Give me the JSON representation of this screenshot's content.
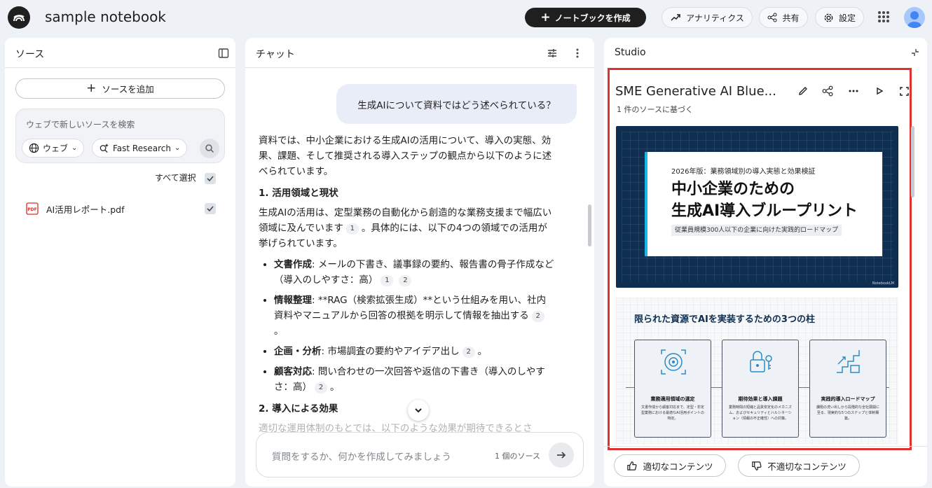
{
  "app": {
    "notebook_title": "sample notebook",
    "create_notebook_label": "ノートブックを作成",
    "analytics_label": "アナリティクス",
    "share_label": "共有",
    "settings_label": "設定"
  },
  "sources": {
    "title": "ソース",
    "add_source_label": "ソースを追加",
    "search_placeholder": "ウェブで新しいソースを検索",
    "web_chip_label": "ウェブ",
    "research_chip_label": "Fast Research",
    "select_all_label": "すべて選択",
    "items": [
      {
        "label": "AI活用レポート.pdf",
        "file_type": "PDF",
        "checked": true
      }
    ]
  },
  "chat": {
    "title": "チャット",
    "user_message": "生成AIについて資料ではどう述べられている？",
    "intro": "資料では、中小企業における生成AIの活用について、導入の実態、効果、課題、そして推奨される導入ステップの観点から以下のように述べられています。",
    "section1_heading": "1. 活用領域と現状",
    "section1_para_a": "生成AIの活用は、定型業務の自動化から創造的な業務支援まで幅広い領域に及んでいます",
    "section1_para_b": "。具体的には、以下の4つの領域での活用が挙げられています。",
    "bullets": [
      {
        "term": "文書作成",
        "text": ": メールの下書き、議事録の要約、報告書の骨子作成など（導入のしやすさ：高）",
        "cites": [
          "1",
          "2"
        ]
      },
      {
        "term": "情報整理",
        "text": ": **RAG（検索拡張生成）**という仕組みを用い、社内資料やマニュアルから回答の根拠を明示して情報を抽出する",
        "cites": [
          "2"
        ],
        "suffix": "。"
      },
      {
        "term": "企画・分析",
        "text": ": 市場調査の要約やアイデア出し",
        "cites": [
          "2"
        ],
        "suffix": "。"
      },
      {
        "term": "顧客対応",
        "text": ": 問い合わせの一次回答や返信の下書き（導入のしやすさ：高）",
        "cites": [
          "2"
        ],
        "suffix": "。"
      }
    ],
    "section2_heading": "2. 導入による効果",
    "section2_cut": "適切な運用体制のもとでは、以下のような効果が期待できるとさ",
    "cite_1": "1",
    "composer_placeholder": "質問をするか、何かを作成してみましょう",
    "source_count": "1 個のソース"
  },
  "studio": {
    "title": "Studio",
    "doc_title": "SME Generative AI Blue...",
    "based_on": "1 件のソースに基づく",
    "slide1": {
      "kicker": "2026年版：業務領域別の導入実態と効果検証",
      "headline_line1": "中小企業のための",
      "headline_line2": "生成AI導入ブループリント",
      "tag": "従業員規模300人以下の企業に向けた実践的ロードマップ",
      "brand": "NotebookLM"
    },
    "slide2": {
      "title": "限られた資源でAIを実装するための3つの柱",
      "cards": [
        {
          "icon": "target-icon",
          "title": "業務適用領域の選定",
          "text": "文書作成から顧客対応まで、定型・非定型業務における最適なAI活用ポイントの特定。"
        },
        {
          "icon": "lock-key-icon",
          "title": "期待効果と導入課題",
          "text": "業務時間の短縮と品質安定化のメカニズム、およびセキュリティとハルシネーション（情報の不正確性）への対策。"
        },
        {
          "icon": "stairs-icon",
          "title": "実践的導入ロードマップ",
          "text": "課題の洗い出しから段階的な全社展開に至る、現実的な5つのステップと体制構築。"
        }
      ]
    },
    "good_content_label": "適切なコンテンツ",
    "bad_content_label": "不適切なコンテンツ"
  },
  "colors": {
    "accent_dark": "#1f1f1f",
    "highlight_frame": "#e03131",
    "slide_navy": "#0f2f52",
    "slide_cyan": "#1ab8e8"
  }
}
